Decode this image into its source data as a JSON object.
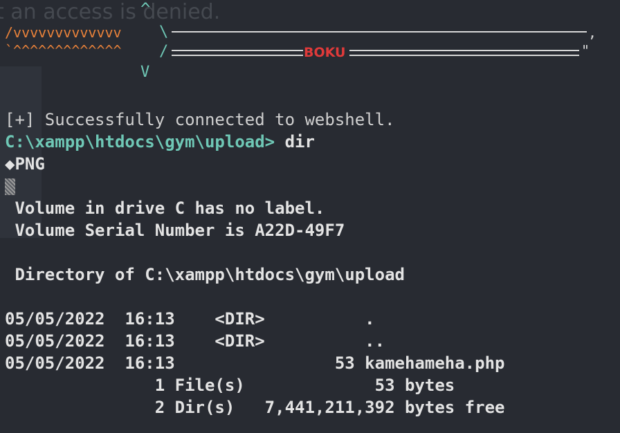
{
  "banner": {
    "faded_text": "t an access is denied.",
    "caret_up": "^",
    "caret_down": "V",
    "v_row": "/vvvvvvvvvvvvv",
    "caret_row": "`^^^^^^^^^^^^^",
    "slash_top": "\\",
    "slash_bottom": "/",
    "tail_top": ",",
    "tail_bottom": "\"",
    "boku": "BOKU"
  },
  "terminal": {
    "connected": "[+] Successfully connected to webshell.",
    "prompt": "C:\\xampp\\htdocs\\gym\\upload>",
    "command": " dir",
    "png": "◆PNG",
    "volume_label": " Volume in drive C has no label.",
    "volume_serial": " Volume Serial Number is A22D-49F7",
    "directory_of": " Directory of C:\\xampp\\htdocs\\gym\\upload",
    "entries": [
      "05/05/2022  16:13    <DIR>          .",
      "05/05/2022  16:13    <DIR>          ..",
      "05/05/2022  16:13                53 kamehameha.php"
    ],
    "summary_files": "               1 File(s)             53 bytes",
    "summary_dirs": "               2 Dir(s)   7,441,211,392 bytes free"
  },
  "colors": {
    "background": "#282b32",
    "prompt": "#6fc8b6",
    "banner_orange": "#e9823a",
    "boku_red": "#e03a3a"
  }
}
